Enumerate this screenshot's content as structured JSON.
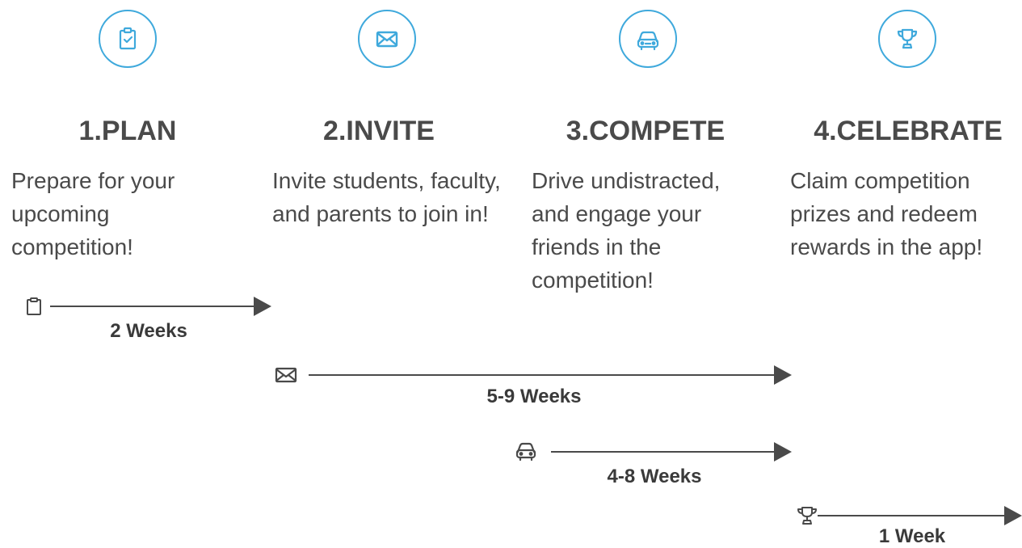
{
  "steps": [
    {
      "title": "1.PLAN",
      "desc": "Prepare for your upcoming competition!",
      "icon": "clipboard-icon"
    },
    {
      "title": "2.INVITE",
      "desc": "Invite students, faculty, and parents to join in!",
      "icon": "envelope-icon"
    },
    {
      "title": "3.COMPETE",
      "desc": "Drive undistracted, and engage your friends in the competition!",
      "icon": "car-icon"
    },
    {
      "title": "4.CELEBRATE",
      "desc": "Claim competition prizes and redeem rewards in the app!",
      "icon": "trophy-icon"
    }
  ],
  "timeline": [
    {
      "label": "2 Weeks",
      "icon": "clipboard-icon"
    },
    {
      "label": "5-9 Weeks",
      "icon": "envelope-icon"
    },
    {
      "label": "4-8 Weeks",
      "icon": "car-icon"
    },
    {
      "label": "1 Week",
      "icon": "trophy-icon"
    }
  ],
  "colors": {
    "accent": "#3fa9dc",
    "text": "#4a4a4a"
  }
}
